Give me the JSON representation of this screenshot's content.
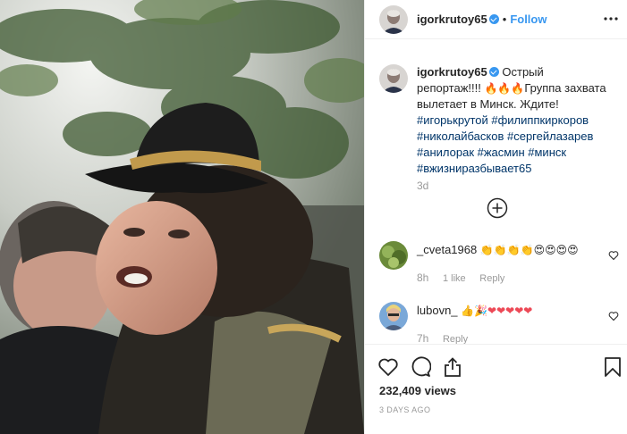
{
  "post": {
    "username": "igorkrutoy65",
    "follow_label": "Follow",
    "separator": "•",
    "caption_line1": "Острый",
    "caption_line2": "репортаж!!!!",
    "caption_line2_rest": "Группа захвата",
    "caption_line3": "вылетает в Минск. Ждите!",
    "caption_emoji": "🔥🔥🔥",
    "hashtags_line1": "#игорькрутой #филиппкиркоров",
    "hashtags_line2": "#николайбасков #сергейлазарев",
    "hashtags_line3": "#анилорак #жасмин #минск",
    "hashtags_line4": "#вжизниразбываеt65",
    "hashtags_line4_exact": "#вжизниразбывает65",
    "age": "3d",
    "load_more_icon": "plus-circle-icon"
  },
  "comments": [
    {
      "username": "_cveta1968",
      "text": "👏👏👏👏😍😍😍😍",
      "age": "8h",
      "likes": "1 like",
      "reply": "Reply"
    },
    {
      "username": "lubovn_",
      "text": "👍🎉❤❤❤❤❤",
      "age": "7h",
      "reply": "Reply"
    }
  ],
  "actions": {
    "views": "232,409 views",
    "posted": "3 DAYS AGO",
    "icons": [
      "heart-icon",
      "comment-icon",
      "share-icon",
      "bookmark-icon"
    ]
  },
  "colors": {
    "accent": "#3897f0",
    "hashtag": "#003569",
    "muted": "#999999",
    "heart": "#ed4956"
  }
}
